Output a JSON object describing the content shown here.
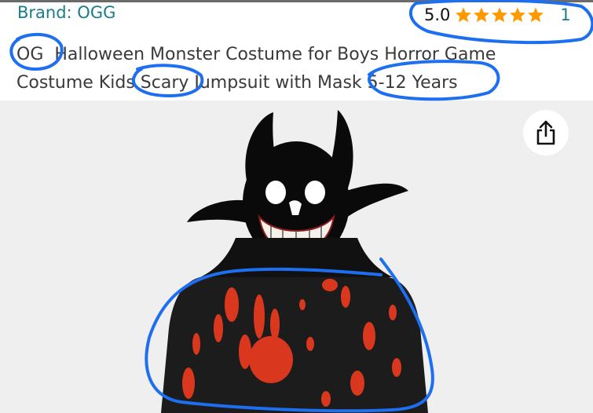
{
  "product": {
    "brand": "Brand: OGG",
    "rating_value": "5.0",
    "rating_stars": 5,
    "rating_count": "1",
    "title_line1": "OG  Halloween Monster Costume for Boys Horror Game",
    "title_line2": "Costume Kids Scary Jumpsuit with Mask 5-12 Years"
  },
  "icons": {
    "share": "share-icon",
    "star": "star-icon"
  },
  "colors": {
    "brand_link": "#1a7d8a",
    "star": "#ff9900",
    "annotation": "#1e6ff0",
    "image_bg": "#efefef"
  }
}
